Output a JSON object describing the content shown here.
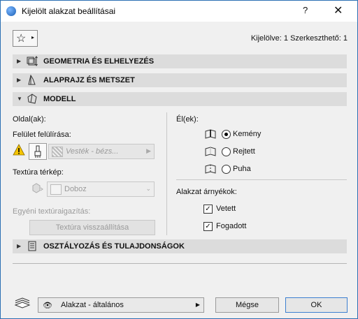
{
  "window": {
    "title": "Kijelölt alakzat beállításai",
    "help": "?",
    "close": "✕"
  },
  "favorites": {
    "star": "☆",
    "arrow": "▸"
  },
  "selection_info": "Kijelölve: 1 Szerkeszthető: 1",
  "panels": {
    "geometry": {
      "label": "GEOMETRIA ÉS ELHELYEZÉS",
      "arrow": "▶"
    },
    "plan": {
      "label": "ALAPRAJZ ÉS METSZET",
      "arrow": "▶"
    },
    "model": {
      "label": "MODELL",
      "arrow": "▼"
    },
    "classification": {
      "label": "OSZTÁLYOZÁS ÉS TULAJDONSÁGOK",
      "arrow": "▶"
    }
  },
  "model": {
    "sides_label": "Oldal(ak):",
    "surface_override_label": "Felület felülírása:",
    "surface_value": "Vesték - bézs...",
    "texture_map_label": "Textúra térkép:",
    "texture_value": "Doboz",
    "custom_texture_label": "Egyéni textúraigazítás:",
    "reset_texture_button": "Textúra visszaállítása",
    "edges_label": "Él(ek):",
    "edges": [
      {
        "label": "Kemény",
        "selected": true
      },
      {
        "label": "Rejtett",
        "selected": false
      },
      {
        "label": "Puha",
        "selected": false
      }
    ],
    "shadows_label": "Alakzat árnyékok:",
    "shadows": [
      {
        "label": "Vetett",
        "checked": true
      },
      {
        "label": "Fogadott",
        "checked": true
      }
    ]
  },
  "footer": {
    "layer_value": "Alakzat - általános",
    "cancel_button": "Mégse",
    "ok_button": "OK"
  },
  "colors": {
    "accent": "#3c7fd0",
    "panel_bg": "#dcdcdc",
    "warning": "#f5c400"
  }
}
